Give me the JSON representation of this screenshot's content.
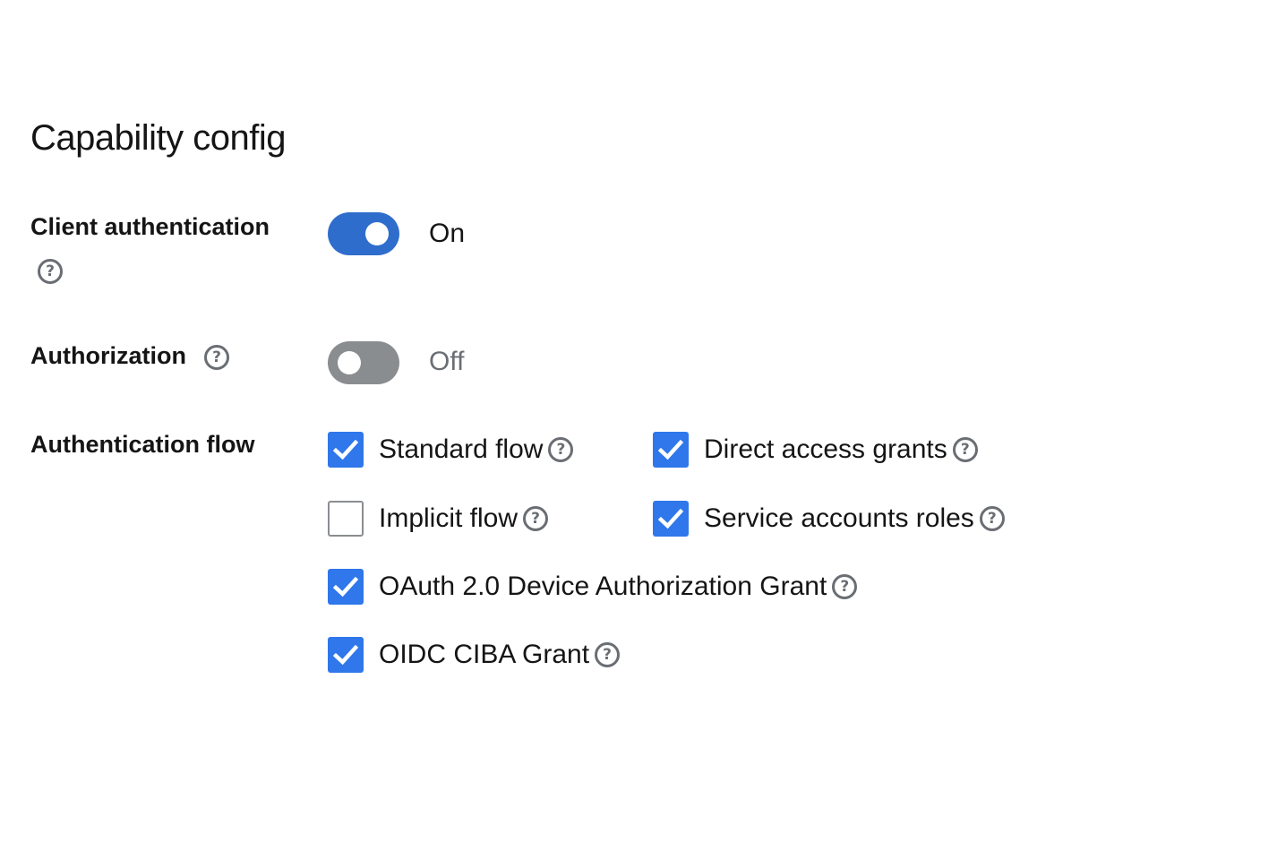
{
  "section": {
    "title": "Capability config"
  },
  "client_authentication": {
    "label": "Client authentication",
    "state": true,
    "state_text": "On",
    "help_icon": "help-circle-icon"
  },
  "authorization": {
    "label": "Authorization",
    "state": false,
    "state_text": "Off",
    "help_icon": "help-circle-icon"
  },
  "authentication_flow": {
    "label": "Authentication flow",
    "options": [
      {
        "label": "Standard flow",
        "checked": true
      },
      {
        "label": "Direct access grants",
        "checked": true
      },
      {
        "label": "Implicit flow",
        "checked": false
      },
      {
        "label": "Service accounts roles",
        "checked": true
      },
      {
        "label": "OAuth 2.0 Device Authorization Grant",
        "checked": true
      },
      {
        "label": "OIDC CIBA Grant",
        "checked": true
      }
    ]
  },
  "help_glyph": "?",
  "colors": {
    "toggle_on": "#2f6dcc",
    "toggle_off": "#8a8d90",
    "checkbox_checked": "#2f77ea",
    "help_icon": "#6a6e73"
  }
}
